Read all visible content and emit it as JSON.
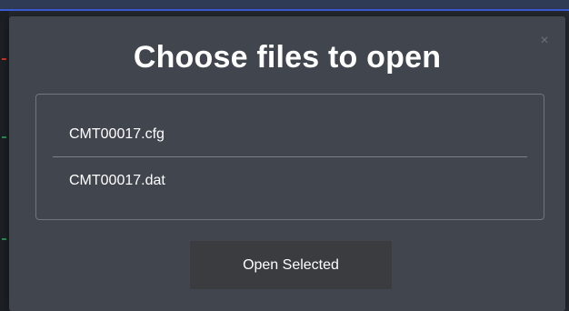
{
  "dialog": {
    "title": "Choose files to open",
    "close_label": "×",
    "files": [
      {
        "name": "CMT00017.cfg"
      },
      {
        "name": "CMT00017.dat"
      }
    ],
    "open_button_label": "Open Selected"
  },
  "colors": {
    "modal_background": "#40454e",
    "button_background": "#3a3c40",
    "border": "#6f7682",
    "text": "#ffffff",
    "close_icon": "#6b717c"
  }
}
